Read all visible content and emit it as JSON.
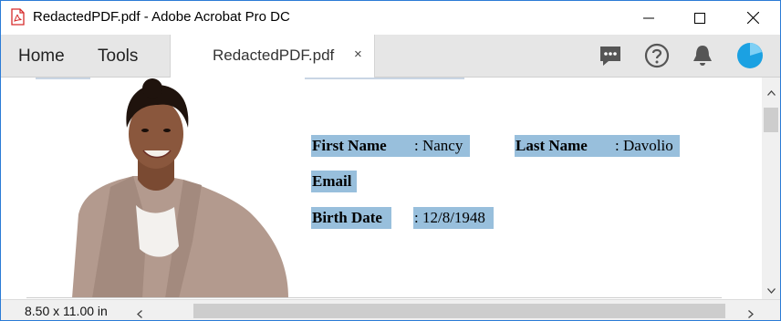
{
  "window": {
    "title": "RedactedPDF.pdf - Adobe Acrobat Pro DC",
    "icon": "pdf-file-icon",
    "controls": [
      "minimize-icon",
      "maximize-icon",
      "close-icon"
    ]
  },
  "toolbar": {
    "home_label": "Home",
    "tools_label": "Tools",
    "tab_label": "RedactedPDF.pdf",
    "tab_close": "×",
    "icons": [
      "comment-icon",
      "help-icon",
      "notification-bell-icon",
      "account-avatar-icon"
    ]
  },
  "document": {
    "photo": "employee-photo",
    "fields": {
      "first_name_label": "First Name",
      "first_name_value": ": Nancy",
      "last_name_label": "Last Name",
      "last_name_value": ": Davolio",
      "email_label": "Email",
      "birth_date_label": "Birth Date",
      "birth_date_value": ": 12/8/1948"
    }
  },
  "status": {
    "page_size": "8.50 x 11.00 in"
  },
  "colors": {
    "highlight": "#98bfdc",
    "toolbar_bg": "#e6e6e6",
    "window_border": "#2b7bd6",
    "pdf_red": "#d62b2b",
    "accent_blue": "#1ba1e2"
  }
}
